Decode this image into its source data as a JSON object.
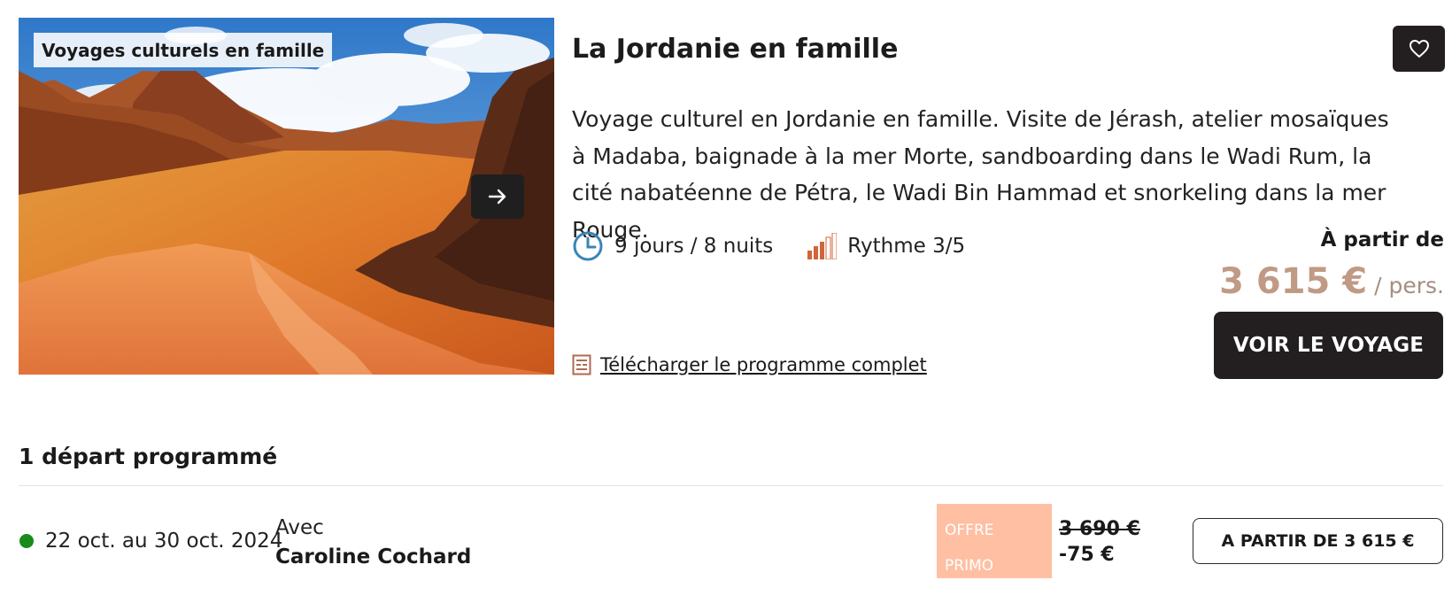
{
  "card": {
    "tag": "Voyages culturels en famille",
    "title": "La Jordanie en famille",
    "description": "Voyage culturel en Jordanie en famille. Visite de Jérash, atelier mosaïques à Madaba, baignade à la mer Morte, sandboarding dans le Wadi Rum, la cité nabatéenne de Pétra, le Wadi Bin Hammad et snorkeling dans la mer Rouge.",
    "duration": "9 jours / 8 nuits",
    "rhythm": "Rythme 3/5",
    "rhythm_level": 3,
    "rhythm_max": 5,
    "download_link": "Télécharger le programme complet",
    "from_label": "À partir de",
    "price": "3 615 €",
    "price_unit": "/ pers.",
    "cta": "VOIR LE VOYAGE"
  },
  "departures": {
    "heading": "1 départ programmé",
    "items": [
      {
        "dates": "22 oct. au 30 oct. 2024",
        "with_label": "Avec",
        "guide": "Caroline Cochard",
        "offer_line1": "OFFRE",
        "offer_line2": "PRIMO",
        "old_price": "3 690 €",
        "discount": "-75 €",
        "button": "A PARTIR DE 3 615 €"
      }
    ]
  },
  "icons": {
    "next": "arrow-right-icon",
    "favorite": "heart-icon",
    "duration": "clock-icon",
    "rhythm": "rhythm-bars-icon",
    "download": "document-icon"
  },
  "colors": {
    "dark_button": "#231f20",
    "price": "#c09a85",
    "clock_blue": "#3a84b8",
    "rhythm_active": "#d2643a",
    "offer_bg": "#ffbfa3",
    "status_dot": "#1a8a1a"
  }
}
